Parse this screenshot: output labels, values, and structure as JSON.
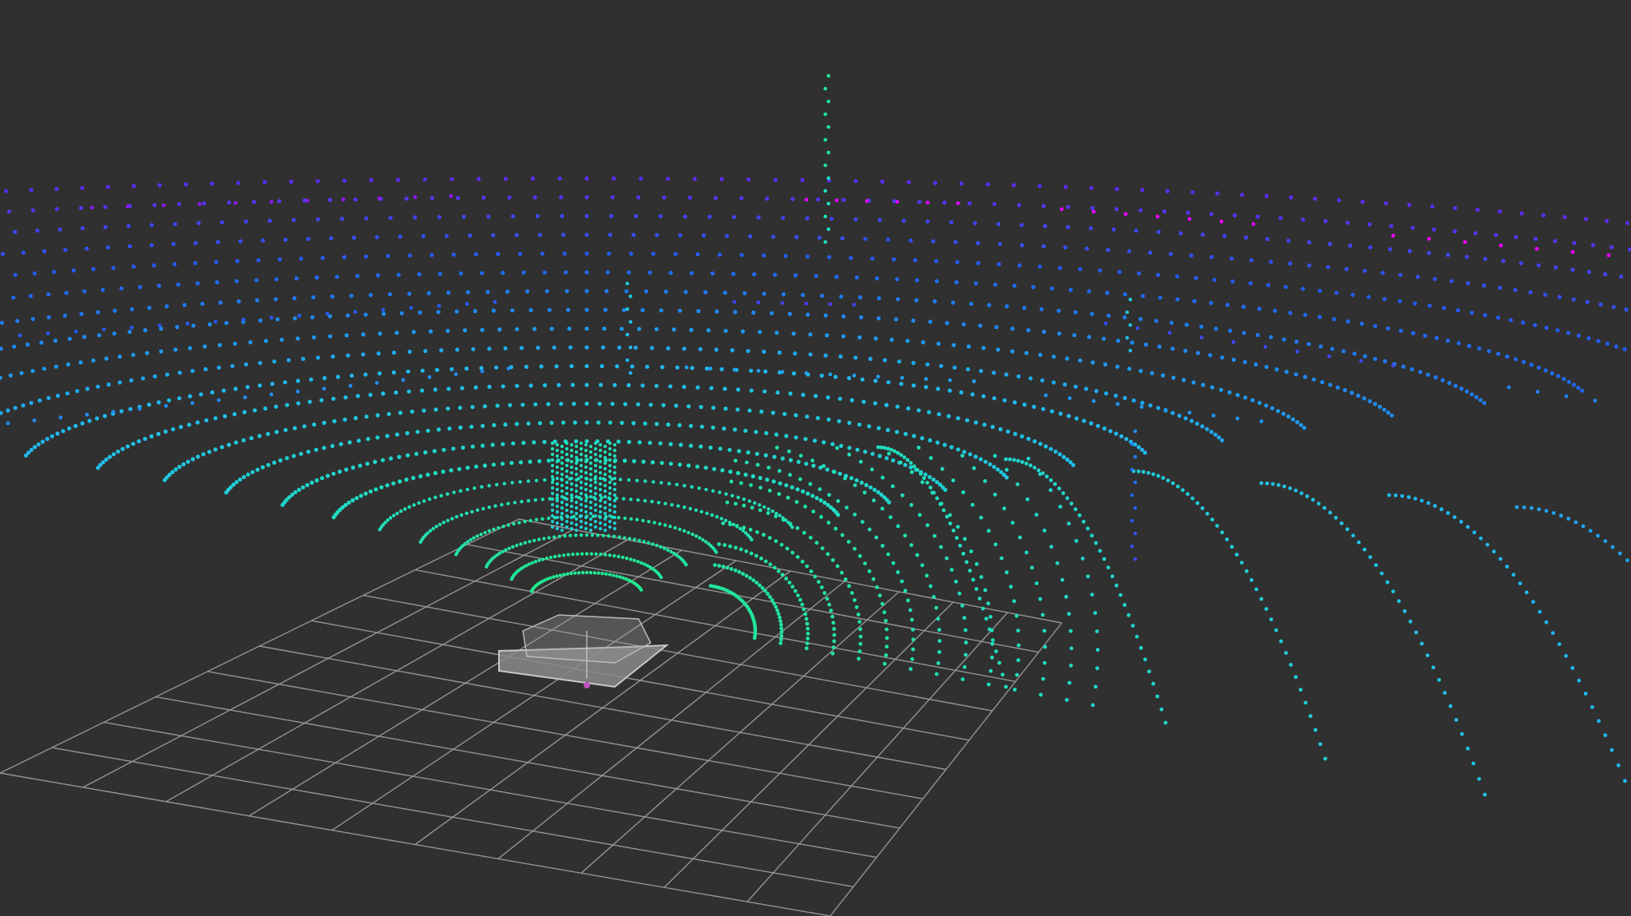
{
  "viewer": {
    "background_color": "#303030",
    "grid_color": "#a0a0a0",
    "grid_cells": 10
  },
  "point_cloud": {
    "colormap": [
      "#ff00ff",
      "#6a20f0",
      "#2060f0",
      "#20b8f0",
      "#20e0c0",
      "#20e890"
    ],
    "near_color": "#1ff58c",
    "far_color": "#ff00ff"
  },
  "robot_model": {
    "body_color": "#8a8a8a",
    "edge_color": "#c8c8c8"
  }
}
